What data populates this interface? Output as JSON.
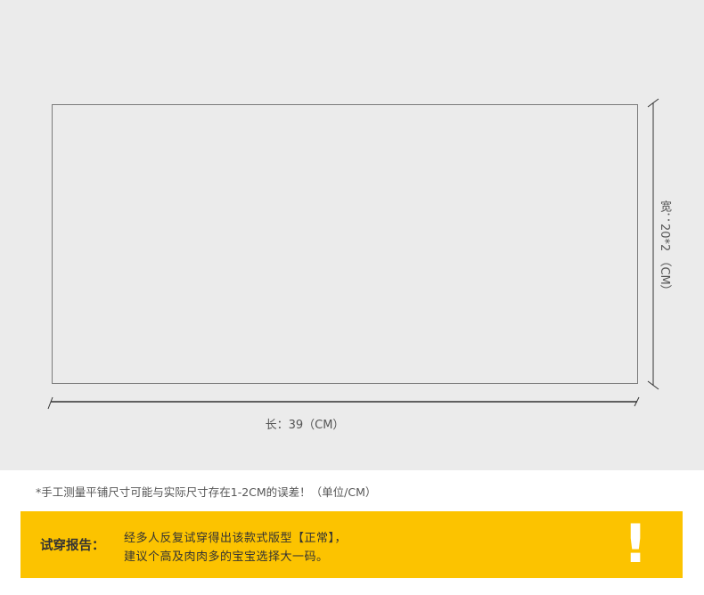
{
  "diagram": {
    "length_label": "长：39（CM）",
    "width_label": "宽：20*2 （CM）"
  },
  "note": "*手工测量平铺尺寸可能与实际尺寸存在1-2CM的误差！（单位/CM）",
  "report": {
    "title": "试穿报告：",
    "line1": "经多人反复试穿得出该款式版型【正常】，",
    "line2": "建议个高及肉肉多的宝宝选择大一码。",
    "icon": "exclamation-icon",
    "bar_color": "#fcc300"
  }
}
